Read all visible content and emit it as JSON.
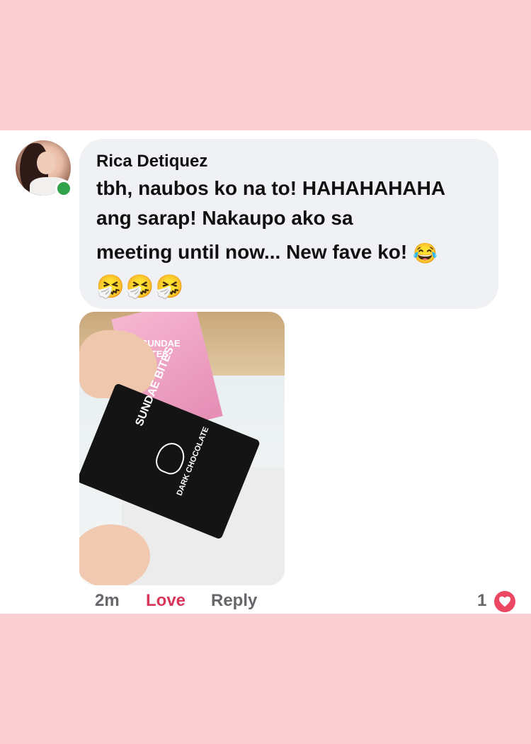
{
  "comment": {
    "author": "Rica Detiquez",
    "lines": [
      "tbh, naubos ko na to! HAHAHAHAHA",
      "ang sarap! Nakaupo ako sa",
      "meeting until now... New fave ko!"
    ],
    "inline_emoji": "😂",
    "trailing_emojis": [
      "🤧",
      "🤧",
      "🤧"
    ]
  },
  "photo": {
    "pink_pack_text": "SUNDAE BITES",
    "black_pack_text": "SUNDAE BITES",
    "black_pack_flavor": "DARK CHOCOLATE"
  },
  "actions": {
    "time": "2m",
    "love": "Love",
    "reply": "Reply",
    "reaction_count": "1",
    "reaction_icon": "heart-icon"
  },
  "colors": {
    "background": "#f9cfd4",
    "bubble": "#f0f1f5",
    "love_active": "#d9365a",
    "online": "#31a24c",
    "heart_badge": "#ec4763"
  }
}
